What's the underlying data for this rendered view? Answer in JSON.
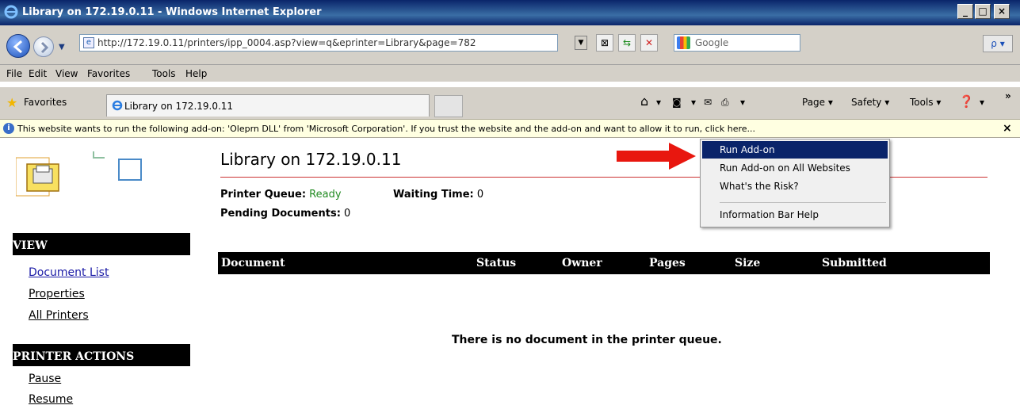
{
  "window": {
    "title": "Library on 172.19.0.11 - Windows Internet Explorer",
    "min": "_",
    "max": "□",
    "close": "×"
  },
  "navbar": {
    "url": "http://172.19.0.11/printers/ipp_0004.asp?view=q&eprinter=Library&page=782",
    "search_placeholder": "Google",
    "search_button": "ρ ▾"
  },
  "menu": [
    "File",
    "Edit",
    "View",
    "Favorites",
    "Tools",
    "Help"
  ],
  "favorites_bar": {
    "favorites_label": "Favorites",
    "tab_title": "Library on 172.19.0.11",
    "commands": [
      "Page ▾",
      "Safety ▾",
      "Tools ▾"
    ]
  },
  "infobar": {
    "message": "This website wants to run the following add-on: 'Oleprn DLL' from 'Microsoft Corporation'. If you trust the website and the add-on and want to allow it to run, click here...",
    "close": "×"
  },
  "context_menu": {
    "items": [
      "Run Add-on",
      "Run Add-on on All Websites",
      "What's the Risk?",
      "Information Bar Help"
    ],
    "selected_index": 0
  },
  "sidebar": {
    "view_heading": "VIEW",
    "view_links": [
      "Document List",
      "Properties",
      "All Printers"
    ],
    "actions_heading": "PRINTER ACTIONS",
    "action_links": [
      "Pause",
      "Resume"
    ]
  },
  "main": {
    "title": "Library on 172.19.0.11",
    "queue_label": "Printer Queue:",
    "queue_value": "Ready",
    "waiting_label": "Waiting Time:",
    "waiting_value": "0",
    "pending_label": "Pending Documents:",
    "pending_value": "0",
    "columns": [
      "Document",
      "Status",
      "Owner",
      "Pages",
      "Size",
      "Submitted"
    ],
    "empty_message": "There is no document in the printer queue."
  },
  "colors": {
    "title_bar": "#0a246a",
    "info_bar": "#ffffe1",
    "status_ready": "#228b22",
    "accent_red": "#cc3333",
    "arrow": "#e8170f"
  }
}
